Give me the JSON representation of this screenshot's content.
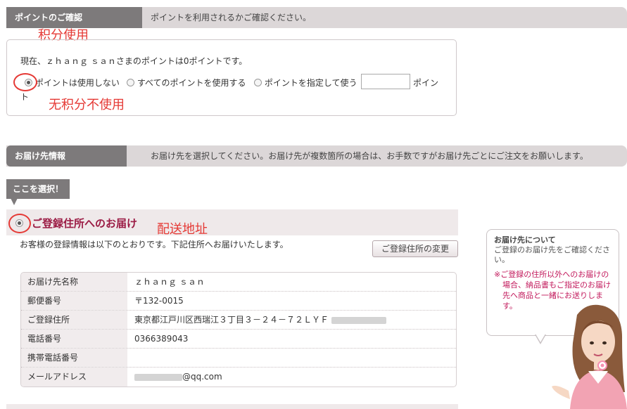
{
  "points_section": {
    "tag": "ポイントのご確認",
    "desc": "ポイントを利用されるかご確認ください。",
    "current_text": "現在、ｚｈａｎｇ ｓａｎさまのポイントは0ポイントです。",
    "options": [
      {
        "label": "ポイントは使用しない",
        "checked": true
      },
      {
        "label": "すべてのポイントを使用する",
        "checked": false
      },
      {
        "label": "ポイントを指定して使う",
        "checked": false
      }
    ],
    "input_value": "",
    "unit_first": "ポイン",
    "unit_second": "ト"
  },
  "delivery_section": {
    "tag": "お届け先情報",
    "desc": "お届け先を選択してください。お届け先が複数箇所の場合は、お手数ですがお届け先ごとにご注文をお願いします。",
    "select_tag": "ここを選択！",
    "registered_title": "ご登録住所へのお届け",
    "registered_note": "お客様の登録情報は以下のとおりです。下記住所へお届けいたします。",
    "change_button": "ご登録住所の変更",
    "rows": [
      {
        "label": "お届け先名称",
        "value": "ｚｈａｎｇ ｓａｎ"
      },
      {
        "label": "郵便番号",
        "value": "〒132-0015"
      },
      {
        "label": "ご登録住所",
        "value": "東京都江戸川区西瑞江３丁目３－２４－７２ＬＹＦ"
      },
      {
        "label": "電話番号",
        "value": "0366389043"
      },
      {
        "label": "携帯電話番号",
        "value": ""
      },
      {
        "label": "メールアドレス",
        "value": "@qq.com"
      }
    ]
  },
  "help_bubble": {
    "title": "お届け先について",
    "text": "ご登録のお届け先をご確認ください。",
    "warning": "※ご登録の住所以外へのお届けの場合、納品書もご指定のお届け先へ商品と一緒にお送りします。"
  },
  "annotations": {
    "use_points": "积分使用",
    "no_points": "无积分不使用",
    "address": "配送地址"
  },
  "colors": {
    "annotation_red": "#e53935",
    "title_crimson": "#9b1b44",
    "header_gray": "#7d7a7b"
  }
}
